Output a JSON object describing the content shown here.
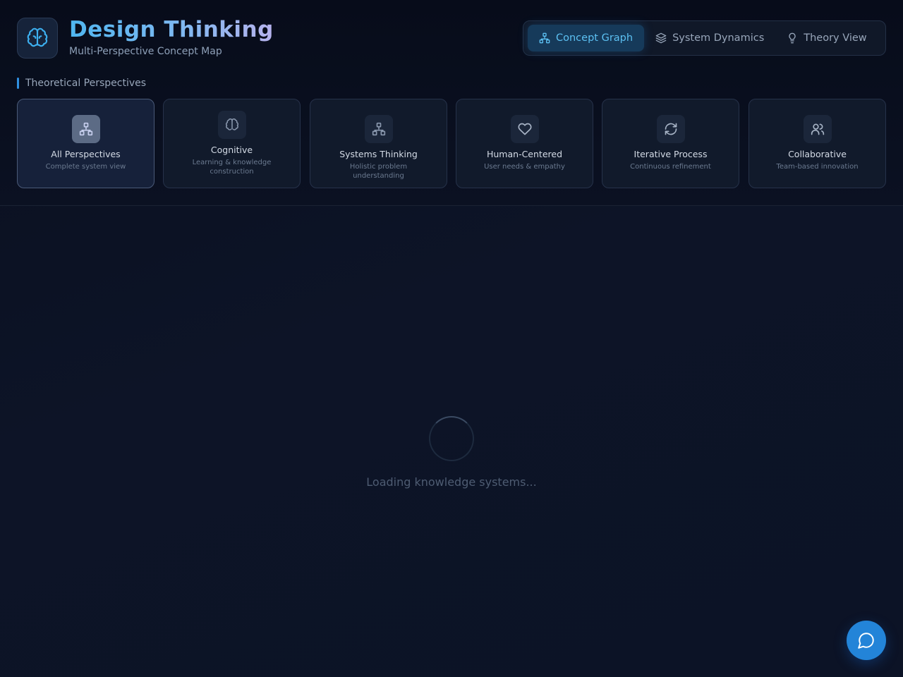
{
  "header": {
    "title": "Design Thinking",
    "subtitle": "Multi-Perspective Concept Map",
    "logo_icon": "brain-icon"
  },
  "view_tabs": [
    {
      "label": "Concept Graph",
      "icon": "network-icon",
      "active": true
    },
    {
      "label": "System Dynamics",
      "icon": "layers-icon",
      "active": false
    },
    {
      "label": "Theory View",
      "icon": "lightbulb-icon",
      "active": false
    }
  ],
  "perspectives": {
    "section_label": "Theoretical Perspectives",
    "items": [
      {
        "title": "All Perspectives",
        "desc": "Complete system view",
        "icon": "network-icon",
        "active": true
      },
      {
        "title": "Cognitive",
        "desc": "Learning & knowledge construction",
        "icon": "brain-icon",
        "active": false
      },
      {
        "title": "Systems Thinking",
        "desc": "Holistic problem understanding",
        "icon": "network-icon",
        "active": false
      },
      {
        "title": "Human-Centered",
        "desc": "User needs & empathy",
        "icon": "heart-icon",
        "active": false
      },
      {
        "title": "Iterative Process",
        "desc": "Continuous refinement",
        "icon": "refresh-icon",
        "active": false
      },
      {
        "title": "Collaborative",
        "desc": "Team-based innovation",
        "icon": "users-icon",
        "active": false
      }
    ]
  },
  "loading": {
    "text": "Loading knowledge systems..."
  },
  "chat_button": {
    "icon": "chat-bubble-icon"
  },
  "colors": {
    "accent": "#2f8fe0",
    "active_tab_text": "#5cc0f2",
    "background": "#0b1020"
  }
}
